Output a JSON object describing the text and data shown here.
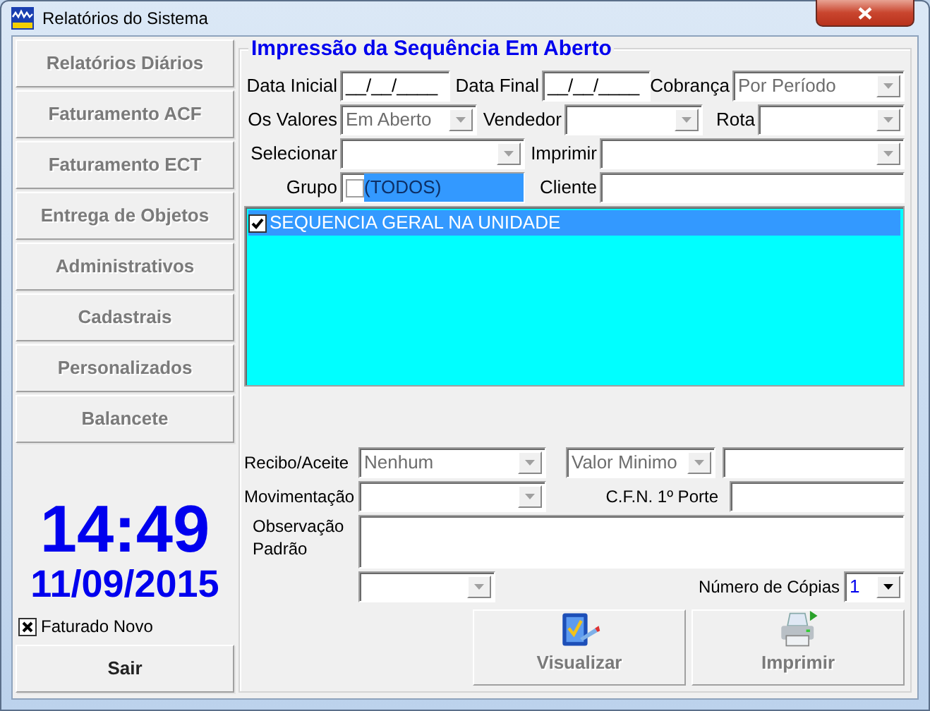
{
  "window": {
    "title": "Relatórios do Sistema"
  },
  "nav_buttons": [
    {
      "label": "Relatórios Diários",
      "disabled": true
    },
    {
      "label": "Faturamento ACF",
      "disabled": true
    },
    {
      "label": "Faturamento ECT",
      "disabled": true
    },
    {
      "label": "Entrega de Objetos",
      "disabled": true
    },
    {
      "label": "Administrativos",
      "disabled": true
    },
    {
      "label": "Cadastrais",
      "disabled": true
    },
    {
      "label": "Personalizados",
      "disabled": true
    },
    {
      "label": "Balancete",
      "disabled": true
    }
  ],
  "clock": {
    "time": "14:49",
    "date": "11/09/2015"
  },
  "faturado_novo": {
    "label": "Faturado Novo",
    "checked": true
  },
  "exit_button": {
    "label": "Sair"
  },
  "group": {
    "title": "Impressão da Sequência Em Aberto",
    "filters": [
      [
        {
          "kind": "label",
          "text": "Data Inicial"
        },
        {
          "kind": "date",
          "value": "__/__/____"
        },
        {
          "kind": "label",
          "text": "Data Final"
        },
        {
          "kind": "date",
          "value": "__/__/____"
        },
        {
          "kind": "label",
          "text": "Cobrança"
        },
        {
          "kind": "combo",
          "value": "Por Período",
          "disabled": true
        }
      ],
      [
        {
          "kind": "label",
          "text": "Os Valores"
        },
        {
          "kind": "combo",
          "value": "Em Aberto",
          "disabled": true
        },
        {
          "kind": "label",
          "text": "Vendedor"
        },
        {
          "kind": "combo",
          "disabled": true
        },
        {
          "kind": "label",
          "text": "Rota"
        },
        {
          "kind": "combo",
          "disabled": true
        }
      ],
      [
        {
          "kind": "label",
          "text": "Selecionar"
        },
        {
          "kind": "combo",
          "disabled": true
        },
        {
          "kind": "label",
          "text": "Imprimir"
        },
        {
          "kind": "combo",
          "disabled": true
        }
      ],
      [
        {
          "kind": "label",
          "text": "Grupo"
        },
        {
          "kind": "group",
          "value": "(TODOS)",
          "checked": false
        },
        {
          "kind": "label",
          "text": "Cliente"
        },
        {
          "kind": "text"
        }
      ]
    ],
    "sequence_list": [
      {
        "label": "SEQUENCIA GERAL NA UNIDADE",
        "checked": true,
        "selected": true
      }
    ],
    "options": [
      [
        {
          "kind": "label",
          "text": "Recibo/Aceite"
        },
        {
          "kind": "combo",
          "value": "Nenhum",
          "disabled": true
        },
        {
          "kind": "combo",
          "value": "Valor Minimo",
          "disabled": true
        },
        {
          "kind": "text"
        }
      ],
      [
        {
          "kind": "label",
          "text": "Movimentação"
        },
        {
          "kind": "combo",
          "disabled": true
        },
        {
          "kind": "label",
          "text": "C.F.N. 1º Porte"
        },
        {
          "kind": "text"
        }
      ],
      [
        {
          "kind": "label",
          "text": "Observação Padrão"
        },
        {
          "kind": "textarea"
        }
      ],
      [
        {
          "kind": "combo",
          "disabled": true
        },
        {
          "kind": "label",
          "text": "Número de Cópias"
        },
        {
          "kind": "combo",
          "value": "1",
          "disabled": false
        }
      ]
    ],
    "actions": [
      {
        "label": "Visualizar",
        "kind": "preview",
        "disabled": true
      },
      {
        "label": "Imprimir",
        "kind": "print",
        "disabled": true
      }
    ]
  }
}
